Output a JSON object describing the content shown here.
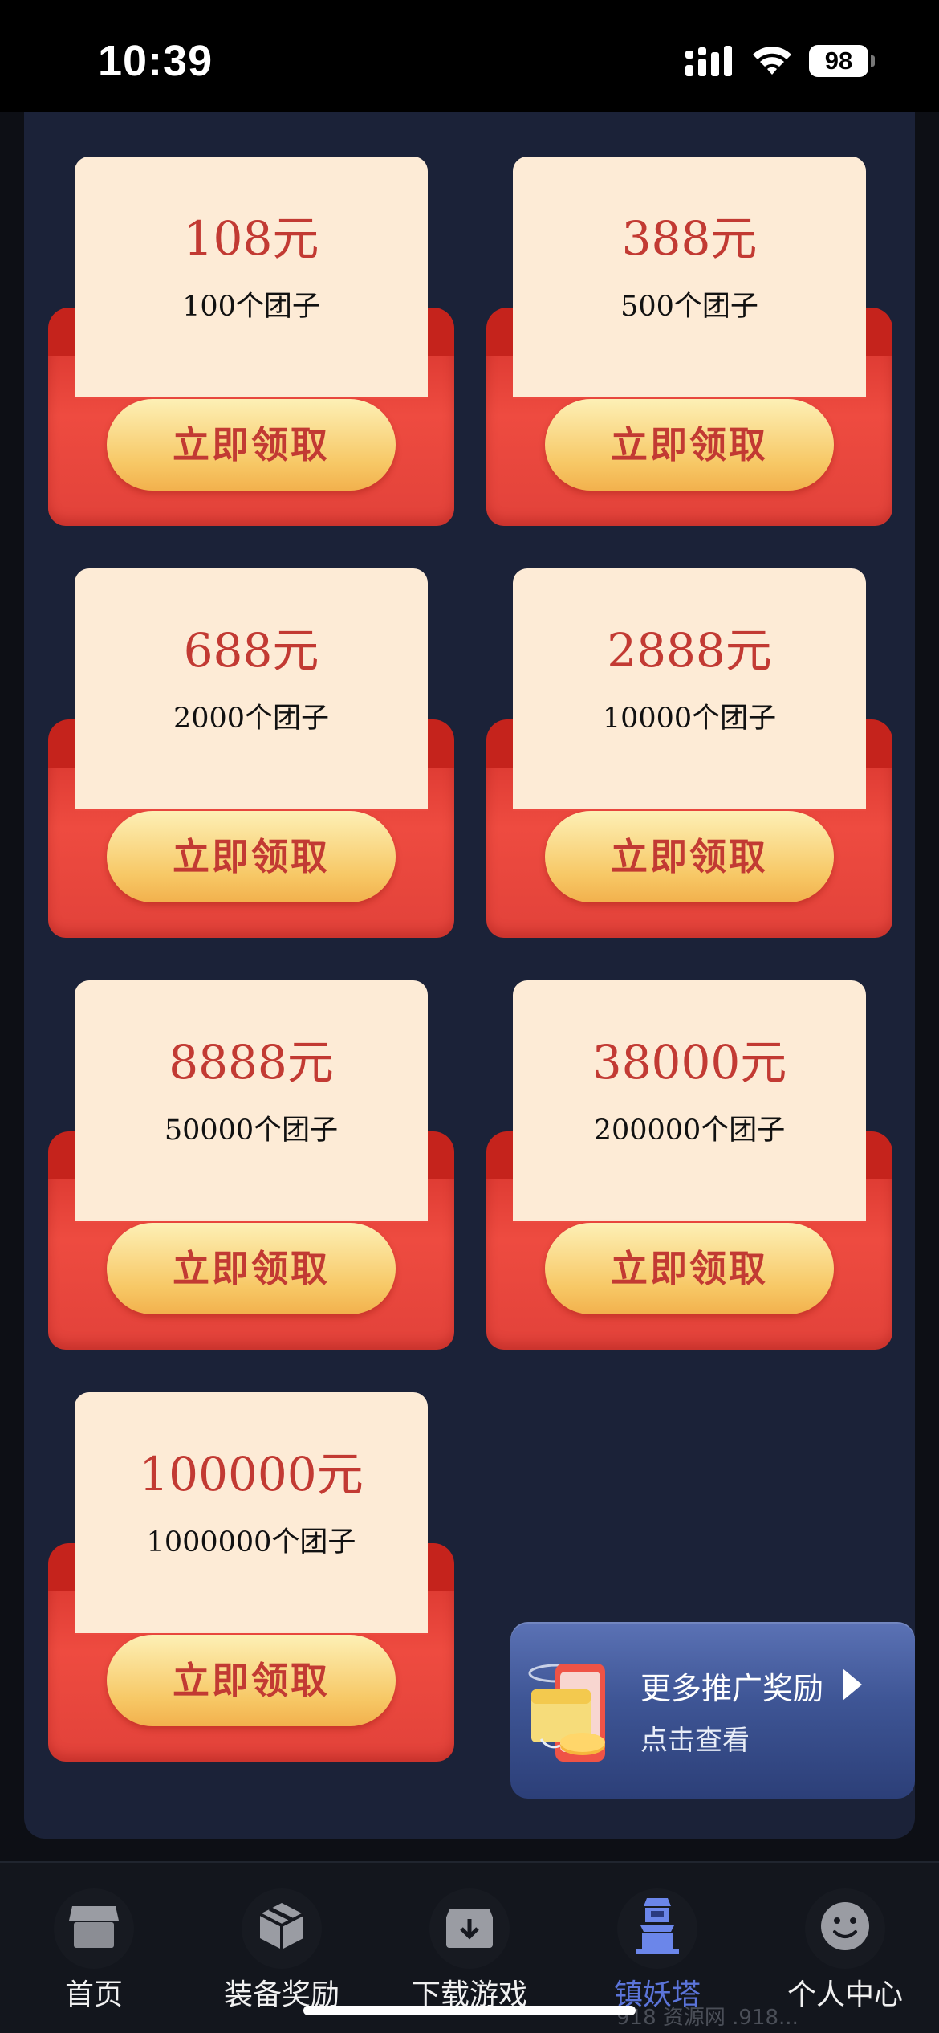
{
  "status_bar": {
    "time": "10:39",
    "battery": "98"
  },
  "rewards": [
    {
      "amount": "108元",
      "desc": "100个团子",
      "button": "立即领取"
    },
    {
      "amount": "388元",
      "desc": "500个团子",
      "button": "立即领取"
    },
    {
      "amount": "688元",
      "desc": "2000个团子",
      "button": "立即领取"
    },
    {
      "amount": "2888元",
      "desc": "10000个团子",
      "button": "立即领取"
    },
    {
      "amount": "8888元",
      "desc": "50000个团子",
      "button": "立即领取"
    },
    {
      "amount": "38000元",
      "desc": "200000个团子",
      "button": "立即领取"
    },
    {
      "amount": "100000元",
      "desc": "1000000个团子",
      "button": "立即领取"
    }
  ],
  "promo": {
    "title": "更多推广奖励",
    "subtitle": "点击查看"
  },
  "tabbar": {
    "items": [
      {
        "label": "首页",
        "icon": "store-icon"
      },
      {
        "label": "装备奖励",
        "icon": "box-icon"
      },
      {
        "label": "下载游戏",
        "icon": "download-icon"
      },
      {
        "label": "镇妖塔",
        "icon": "tower-icon",
        "active": true
      },
      {
        "label": "个人中心",
        "icon": "smiley-icon"
      }
    ]
  },
  "watermark": "918 资源网 .918..."
}
